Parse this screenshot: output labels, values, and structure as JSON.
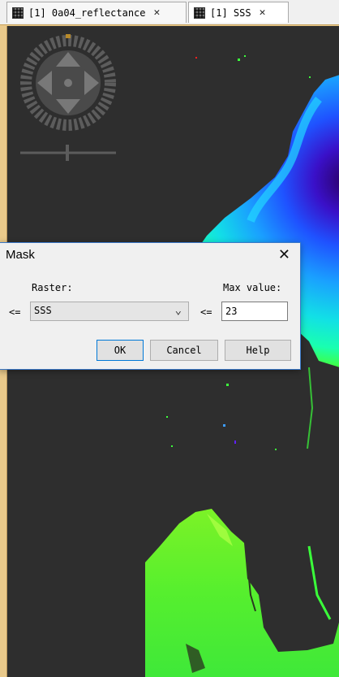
{
  "tabs": [
    {
      "label": "[1] 0a04_reflectance",
      "close": "✕"
    },
    {
      "label": "[1] SSS",
      "close": "✕",
      "active": true
    }
  ],
  "dialog": {
    "title": "Mask",
    "close": "✕",
    "raster_label": "Raster:",
    "max_label": "Max value:",
    "left_op": "<=",
    "right_op": "<=",
    "raster_value": "SSS",
    "max_value": "23",
    "buttons": {
      "ok": "OK",
      "cancel": "Cancel",
      "help": "Help"
    }
  },
  "icons": {
    "tab_icon": "raster-grid-icon",
    "navigator": "pan-navigation-icon",
    "dropdown": "chevron-down-icon"
  },
  "colors": {
    "background": "#2e2e2e",
    "frame": "#e9c98b",
    "accent": "#0078d7"
  }
}
